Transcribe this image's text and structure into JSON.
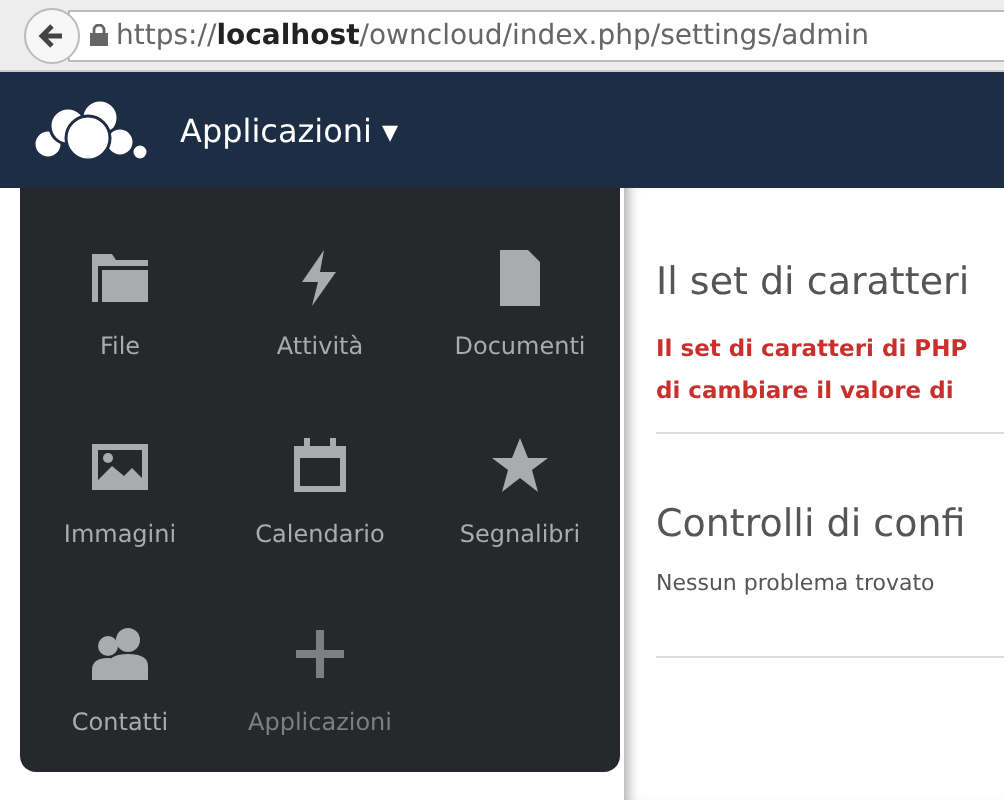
{
  "address_bar": {
    "url": "https://**localhost**/owncloud/index.php/settings/admin"
  },
  "header": {
    "app_menu": {
      "label": "Applicazioni",
      "caret": "▾",
      "expanded": true
    }
  },
  "apps_menu": [
    {
      "label": "File",
      "kind": "app"
    },
    {
      "label": "Attività",
      "kind": "app"
    },
    {
      "label": "Documenti",
      "kind": "app"
    },
    {
      "label": "Immagini",
      "kind": "app"
    },
    {
      "label": "Calendario",
      "kind": "app"
    },
    {
      "label": "Segnalibri",
      "kind": "app"
    },
    {
      "label": "Contatti",
      "kind": "app"
    },
    {
      "label": "Applicazioni",
      "kind": "add"
    }
  ],
  "sections": [
    {
      "title": "Il set di caratteri",
      "warning_lines": [
        "Il set di caratteri di PHP",
        "di cambiare il valore di"
      ]
    },
    {
      "title": "Controlli di confi",
      "text": "Nessun problema trovato"
    }
  ]
}
